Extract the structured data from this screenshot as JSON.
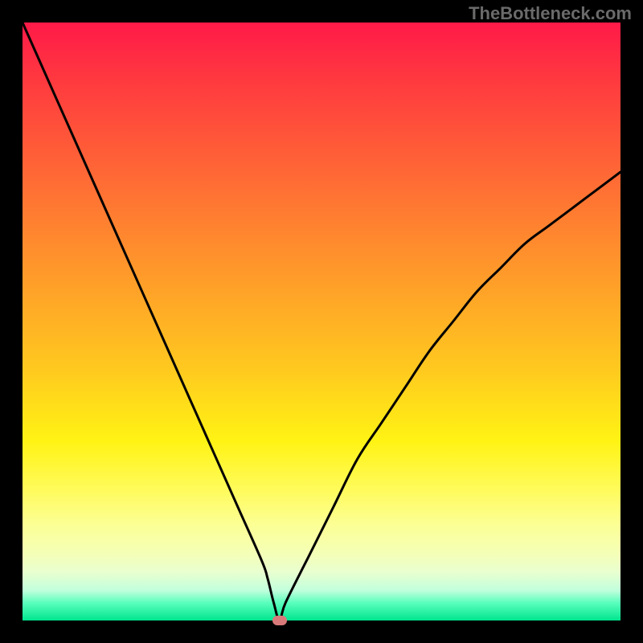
{
  "watermark": "TheBottleneck.com",
  "chart_data": {
    "type": "line",
    "title": "",
    "xlabel": "",
    "ylabel": "",
    "xlim": [
      0,
      100
    ],
    "ylim": [
      0,
      100
    ],
    "x": [
      0,
      4,
      8,
      12,
      16,
      20,
      24,
      28,
      32,
      36,
      40,
      41,
      42,
      43,
      44,
      48,
      52,
      56,
      60,
      64,
      68,
      72,
      76,
      80,
      84,
      88,
      92,
      96,
      100
    ],
    "y": [
      100,
      91,
      82,
      73,
      64,
      55,
      46,
      37,
      28,
      19,
      10,
      7,
      3,
      0,
      3,
      11,
      19,
      27,
      33,
      39,
      45,
      50,
      55,
      59,
      63,
      66,
      69,
      72,
      75
    ],
    "marker": {
      "x": 43,
      "y": 0
    },
    "annotations": []
  }
}
